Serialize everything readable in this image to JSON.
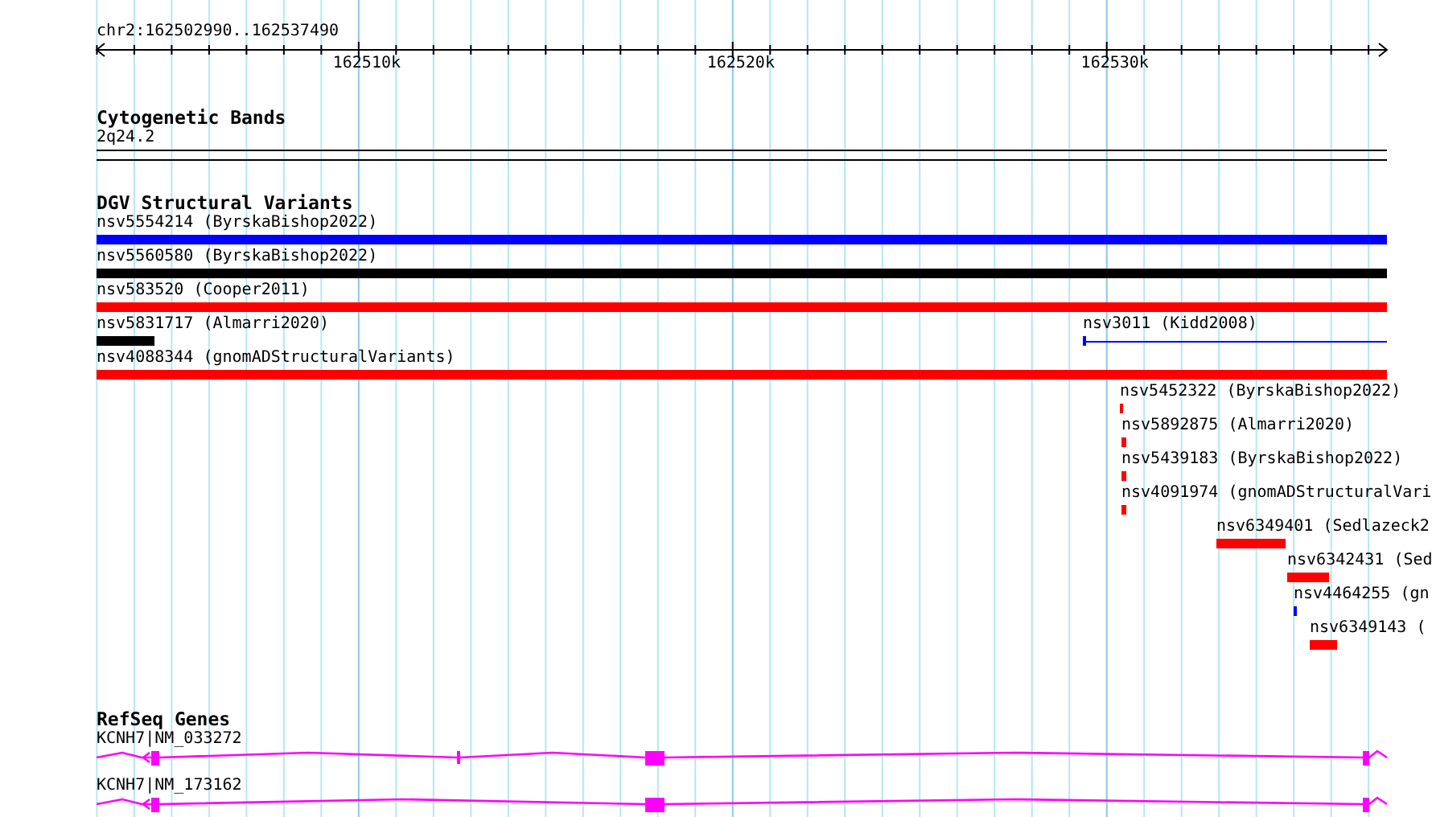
{
  "ruler": {
    "position": "chr2:162502990..162537490",
    "ticks": [
      "162510k",
      "162520k",
      "162530k"
    ]
  },
  "cytogenetic_bands": {
    "title": "Cytogenetic Bands",
    "band": "2q24.2"
  },
  "dgv_structural_variants": {
    "title": "DGV Structural Variants",
    "rows": [
      {
        "features": [
          {
            "label": "nsv5554214 (ByrskaBishop2022)",
            "color": "#0000ff",
            "kind": "bar"
          }
        ]
      },
      {
        "features": [
          {
            "label": "nsv5560580 (ByrskaBishop2022)",
            "color": "#000000",
            "kind": "bar"
          }
        ]
      },
      {
        "features": [
          {
            "label": "nsv583520 (Cooper2011)",
            "color": "#ff0000",
            "kind": "bar"
          }
        ]
      },
      {
        "features": [
          {
            "label": "nsv5831717 (Almarri2020)",
            "color": "#000000",
            "kind": "bar"
          },
          {
            "label": "nsv3011 (Kidd2008)",
            "color": "#0000ff",
            "kind": "line"
          }
        ]
      },
      {
        "features": [
          {
            "label": "nsv4088344 (gnomADStructuralVariants)",
            "color": "#ff0000",
            "kind": "bar"
          }
        ]
      },
      {
        "features": [
          {
            "label": "nsv5452322 (ByrskaBishop2022)",
            "color": "#ff0000",
            "kind": "bar"
          }
        ]
      },
      {
        "features": [
          {
            "label": "nsv5892875 (Almarri2020)",
            "color": "#ff0000",
            "kind": "bar"
          }
        ]
      },
      {
        "features": [
          {
            "label": "nsv5439183 (ByrskaBishop2022)",
            "color": "#ff0000",
            "kind": "bar"
          }
        ]
      },
      {
        "features": [
          {
            "label": "nsv4091974 (gnomADStructuralVari",
            "color": "#ff0000",
            "kind": "bar"
          }
        ]
      },
      {
        "features": [
          {
            "label": "nsv6349401 (Sedlazeck2",
            "color": "#ff0000",
            "kind": "bar"
          }
        ]
      },
      {
        "features": [
          {
            "label": "nsv6342431 (Sed",
            "color": "#ff0000",
            "kind": "bar"
          }
        ]
      },
      {
        "features": [
          {
            "label": "nsv4464255 (gn",
            "color": "#0000ff",
            "kind": "bar"
          }
        ]
      },
      {
        "features": [
          {
            "label": "nsv6349143 (",
            "color": "#ff0000",
            "kind": "bar"
          }
        ]
      }
    ]
  },
  "refseq_genes": {
    "title": "RefSeq Genes",
    "transcripts": [
      {
        "label": "KCNH7|NM_033272"
      },
      {
        "label": "KCNH7|NM_173162"
      }
    ]
  }
}
